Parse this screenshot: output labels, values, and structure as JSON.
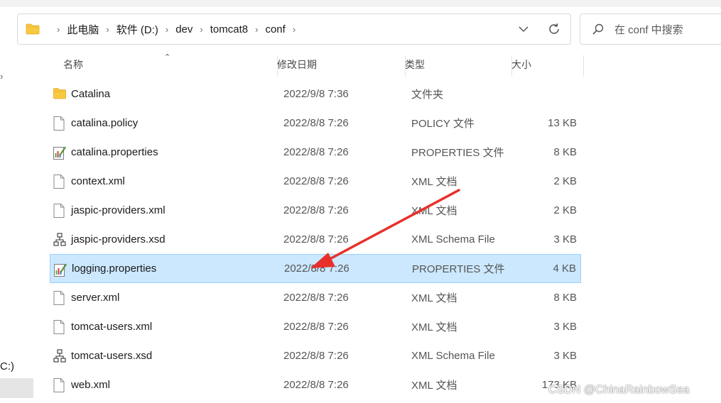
{
  "address": {
    "breadcrumbs": [
      "此电脑",
      "软件 (D:)",
      "dev",
      "tomcat8",
      "conf"
    ]
  },
  "search": {
    "placeholder": "在 conf 中搜索"
  },
  "nav": {
    "drive_fragment": "C:)"
  },
  "columns": {
    "name": "名称",
    "date": "修改日期",
    "type": "类型",
    "size": "大小"
  },
  "files": [
    {
      "name": "Catalina",
      "date": "2022/9/8 7:36",
      "type": "文件夹",
      "size": "",
      "icon": "folder-icon"
    },
    {
      "name": "catalina.policy",
      "date": "2022/8/8 7:26",
      "type": "POLICY 文件",
      "size": "13 KB",
      "icon": "file-icon"
    },
    {
      "name": "catalina.properties",
      "date": "2022/8/8 7:26",
      "type": "PROPERTIES 文件",
      "size": "8 KB",
      "icon": "properties-file-icon"
    },
    {
      "name": "context.xml",
      "date": "2022/8/8 7:26",
      "type": "XML 文档",
      "size": "2 KB",
      "icon": "file-icon"
    },
    {
      "name": "jaspic-providers.xml",
      "date": "2022/8/8 7:26",
      "type": "XML 文档",
      "size": "2 KB",
      "icon": "file-icon"
    },
    {
      "name": "jaspic-providers.xsd",
      "date": "2022/8/8 7:26",
      "type": "XML Schema File",
      "size": "3 KB",
      "icon": "schema-file-icon"
    },
    {
      "name": "logging.properties",
      "date": "2022/8/8 7:26",
      "type": "PROPERTIES 文件",
      "size": "4 KB",
      "icon": "properties-file-icon",
      "selected": true
    },
    {
      "name": "server.xml",
      "date": "2022/8/8 7:26",
      "type": "XML 文档",
      "size": "8 KB",
      "icon": "file-icon"
    },
    {
      "name": "tomcat-users.xml",
      "date": "2022/8/8 7:26",
      "type": "XML 文档",
      "size": "3 KB",
      "icon": "file-icon"
    },
    {
      "name": "tomcat-users.xsd",
      "date": "2022/8/8 7:26",
      "type": "XML Schema File",
      "size": "3 KB",
      "icon": "schema-file-icon"
    },
    {
      "name": "web.xml",
      "date": "2022/8/8 7:26",
      "type": "XML 文档",
      "size": "173 KB",
      "icon": "file-icon"
    }
  ],
  "colors": {
    "selection_bg": "#cce8ff",
    "selection_border": "#99d1ff",
    "annotation_arrow": "#e8302a",
    "folder": "#f8c93e"
  },
  "watermark": "CSDN @ChinaRainbowSea"
}
